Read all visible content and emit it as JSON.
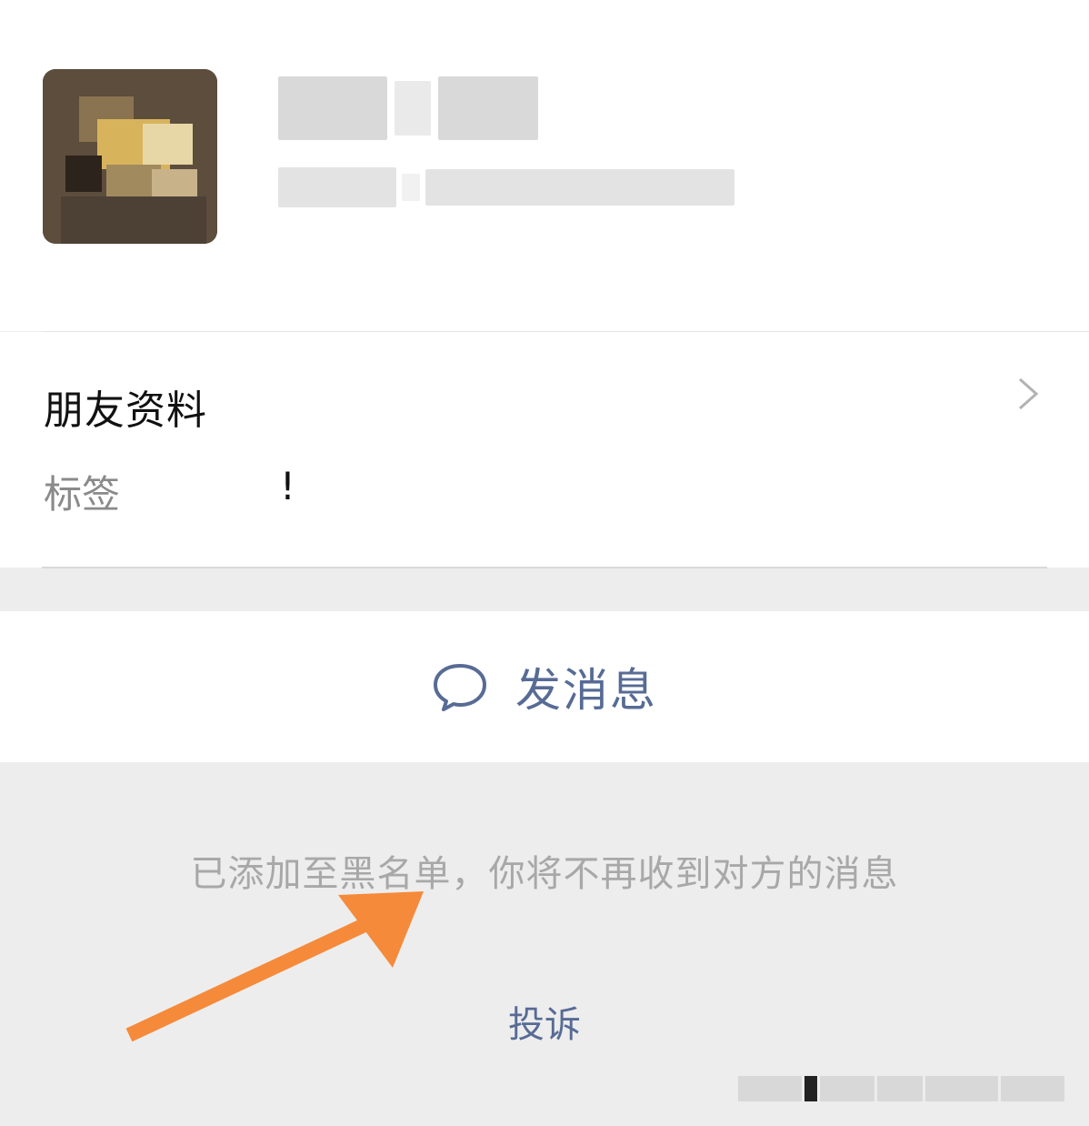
{
  "profile": {
    "avatar": "blurred-avatar",
    "name": "",
    "subtitle": ""
  },
  "info": {
    "title": "朋友资料",
    "tag_label": "标签",
    "tag_value": "!"
  },
  "actions": {
    "send_message_label": "发消息",
    "send_message_icon": "chat-bubble-icon"
  },
  "notice": {
    "text": "已添加至黑名单，你将不再收到对方的消息"
  },
  "complain": {
    "label": "投诉"
  },
  "colors": {
    "link": "#576b95",
    "arrow": "#f58a3a",
    "muted": "#a8a8a8"
  }
}
